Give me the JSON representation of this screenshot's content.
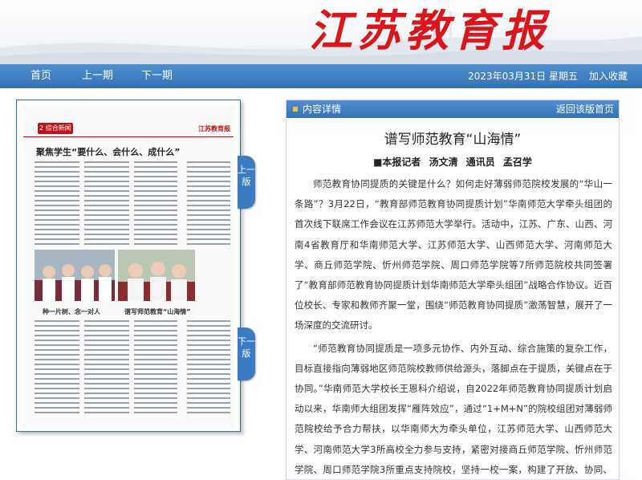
{
  "header": {
    "logo_text": "江苏教育报"
  },
  "nav": {
    "home": "首页",
    "prev_issue": "上一期",
    "next_issue": "下一期",
    "date": "2023年03月31日 星期五",
    "favorite": "加入收藏"
  },
  "newspaper_page": {
    "section_badge": "2 综合新闻",
    "masthead": "江苏教育报",
    "headline": "聚焦学生“要什么、会什么、成什么”",
    "caption_left": "种一片树、念一对人",
    "caption_right": "谱写师范教育“山海情”"
  },
  "page_tabs": {
    "prev": "上一版",
    "next": "下一版"
  },
  "panel": {
    "title": "内容详情",
    "back_link": "返回该版首页"
  },
  "article": {
    "title": "谱写师范教育“山海情”",
    "byline": "■本报记者 汤文清 通讯员 孟召学",
    "paragraphs": [
      "师范教育协同提质的关键是什么？如何走好薄弱师范院校发展的“华山一条路”？3月22日，“教育部师范教育协同提质计划”华南师范大学牵头组团的首次线下联席工作会议在江苏师范大学举行。活动中，江苏、广东、山西、河南4省教育厅和华南师范大学、江苏师范大学、山西师范大学、河南师范大学、商丘师范学院、忻州师范学院、周口师范学院等7所师范院校共同签署了“教育部师范教育协同提质计划华南师范大学牵头组团”战略合作协议。近百位校长、专家和教师齐聚一堂，围绕“师范教育协同提质”激荡智慧，展开了一场深度的交流研讨。",
      "“师范教育协同提质是一项多元协作、内外互动、综合施策的复杂工作，目标直接指向薄弱地区师范院校教师供给源头，落脚点在于提质，关键点在于协同。”华南师范大学校长王恩科介绍说，自2022年师范教育协同提质计划启动以来，华南师大组团发挥“雁阵效应”，通过“1+M+N”的院校组团对薄弱师范院校给予合力帮扶，以华南师大为牵头单位，江苏师范大学、山西师范大学、河南师范大学3所高校全力参与支持，紧密对接商丘师范学院、忻州师范学院、周口师范学院3所重点支持院校，坚持一校一案，构建了开放、协同、联动的工作机制，助力提升重点支持院校的整体实力和师范教育办学水平。"
    ]
  }
}
